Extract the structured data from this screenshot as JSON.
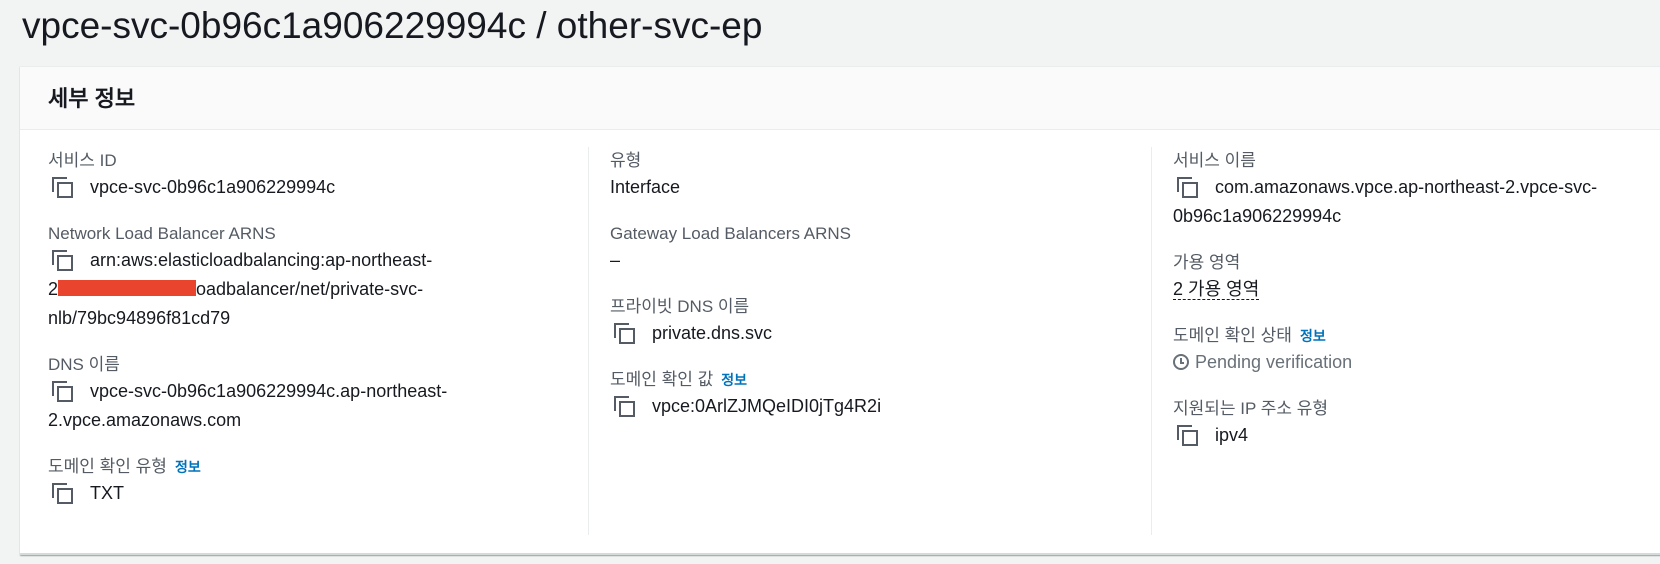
{
  "page": {
    "title": "vpce-svc-0b96c1a906229994c / other-svc-ep"
  },
  "panel": {
    "title": "세부 정보"
  },
  "info_link": "정보",
  "col1": {
    "service_id": {
      "label": "서비스 ID",
      "value": "vpce-svc-0b96c1a906229994c"
    },
    "nlb_arns": {
      "label": "Network Load Balancer ARNS",
      "line1": "arn:aws:elasticloadbalancing:ap-northeast-",
      "line2_prefix": "2",
      "line2_suffix": "oadbalancer/net/private-svc-",
      "line3": "nlb/79bc94896f81cd79"
    },
    "dns_name": {
      "label": "DNS 이름",
      "line1": "vpce-svc-0b96c1a906229994c.ap-northeast-",
      "line2": "2.vpce.amazonaws.com"
    },
    "domain_verification_type": {
      "label": "도메인 확인 유형",
      "value": "TXT"
    }
  },
  "col2": {
    "type": {
      "label": "유형",
      "value": "Interface"
    },
    "gwlb_arns": {
      "label": "Gateway Load Balancers ARNS",
      "value": "–"
    },
    "private_dns_name": {
      "label": "프라이빗 DNS 이름",
      "value": "private.dns.svc"
    },
    "domain_verification_value": {
      "label": "도메인 확인 값",
      "value": "vpce:0ArlZJMQeIDI0jTg4R2i"
    }
  },
  "col3": {
    "service_name": {
      "label": "서비스 이름",
      "line1": "com.amazonaws.vpce.ap-northeast-2.vpce-svc-",
      "line2": "0b96c1a906229994c"
    },
    "availability_zones": {
      "label": "가용 영역",
      "value": "2 가용 영역"
    },
    "domain_verification_status": {
      "label": "도메인 확인 상태",
      "value": "Pending verification"
    },
    "supported_ip_type": {
      "label": "지원되는 IP 주소 유형",
      "value": "ipv4"
    }
  },
  "icons": {
    "copy": "copy-icon",
    "status": "clock-icon"
  },
  "colors": {
    "link": "#0073bb",
    "redaction": "#e8442e",
    "label": "#545b64"
  }
}
